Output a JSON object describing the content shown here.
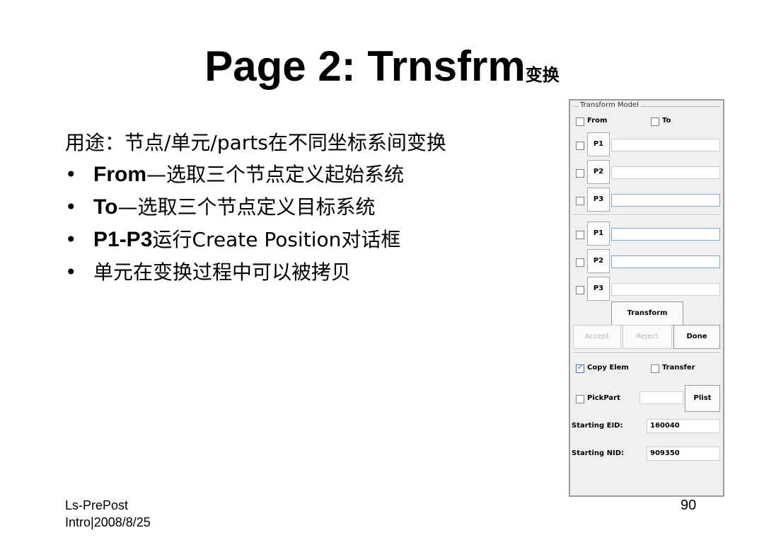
{
  "slide": {
    "title": "Page 2: Trnsfrm",
    "title_suffix": "变换",
    "intro_text": "用途：节点/单元/parts在不同坐标系间变换",
    "bullets": [
      {
        "bold": "From",
        "text": "—选取三个节点定义起始系统"
      },
      {
        "bold": "To",
        "text": "—选取三个节点定义目标系统"
      },
      {
        "bold": "P1-P3",
        "text": "运行Create Position对话框"
      },
      {
        "bold": "",
        "text": "单元在变换过程中可以被拷贝"
      }
    ],
    "bullet_symbol": "•",
    "footer_line1": "Ls-PrePost",
    "footer_line2": "Intro|2008/8/25",
    "page_number": "90"
  },
  "panel": {
    "group_title": "Transform Model",
    "from_label": "From",
    "to_label": "To",
    "from_points": [
      {
        "label": "P1",
        "value": ""
      },
      {
        "label": "P2",
        "value": ""
      },
      {
        "label": "P3",
        "value": ""
      }
    ],
    "to_points": [
      {
        "label": "P1",
        "value": ""
      },
      {
        "label": "P2",
        "value": ""
      },
      {
        "label": "P3",
        "value": ""
      }
    ],
    "transform_label": "Transform",
    "accept_label": "Accept",
    "reject_label": "Reject",
    "done_label": "Done",
    "copy_elem_label": "Copy Elem",
    "copy_elem_checked": true,
    "transfer_label": "Transfer",
    "pickpart_label": "PickPart",
    "pickpart_value": "",
    "plist_label": "Plist",
    "starting_eid_label": "Starting EID:",
    "starting_eid_value": "160040",
    "starting_nid_label": "Starting NID:",
    "starting_nid_value": "909350"
  }
}
